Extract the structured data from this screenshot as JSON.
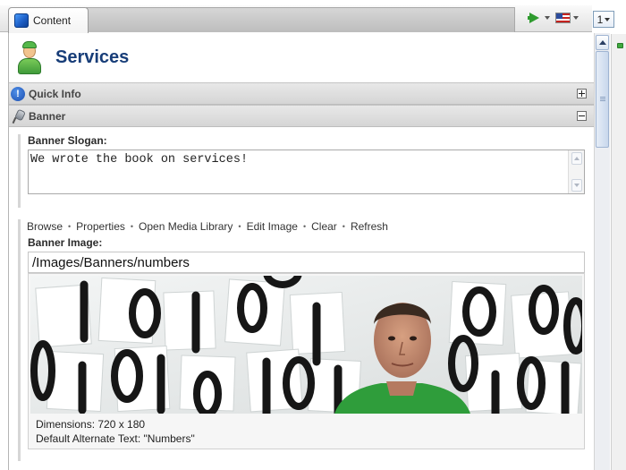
{
  "tab": {
    "label": "Content"
  },
  "version": {
    "value": "1"
  },
  "page": {
    "title": "Services"
  },
  "sections": {
    "quick_info": {
      "title": "Quick Info"
    },
    "banner": {
      "title": "Banner"
    }
  },
  "banner_slogan": {
    "label": "Banner Slogan:",
    "value": "We wrote the book on services!"
  },
  "image_toolbar": {
    "browse": "Browse",
    "properties": "Properties",
    "open_media_library": "Open Media Library",
    "edit_image": "Edit Image",
    "clear": "Clear",
    "refresh": "Refresh",
    "separator": "•"
  },
  "banner_image": {
    "label": "Banner Image:",
    "path": "/Images/Banners/numbers",
    "dimensions": "Dimensions: 720 x 180",
    "alt_text": "Default Alternate Text: \"Numbers\""
  },
  "icons": {
    "tab": "content-cube-icon",
    "page": "person-icon",
    "quick_info": "info-icon",
    "banner": "pin-icon"
  }
}
